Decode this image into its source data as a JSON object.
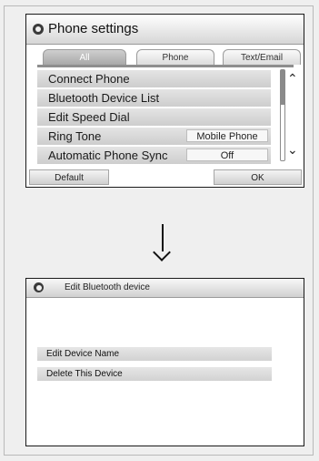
{
  "screen1": {
    "title": "Phone settings",
    "tabs": [
      {
        "label": "All"
      },
      {
        "label": "Phone"
      },
      {
        "label": "Text/Email"
      }
    ],
    "items": [
      {
        "label": "Connect Phone"
      },
      {
        "label": "Bluetooth Device List"
      },
      {
        "label": "Edit Speed Dial"
      },
      {
        "label": "Ring Tone",
        "value": "Mobile Phone"
      },
      {
        "label": "Automatic Phone Sync",
        "value": "Off"
      }
    ],
    "buttons": {
      "default": "Default",
      "ok": "OK"
    },
    "scroll_up_icon": "double-chevron-up",
    "scroll_down_icon": "double-chevron-down"
  },
  "arrow_icon": "down-arrow",
  "screen2": {
    "title": "Edit Bluetooth device",
    "items": [
      {
        "label": "Edit Device Name"
      },
      {
        "label": "Delete This Device"
      }
    ]
  }
}
